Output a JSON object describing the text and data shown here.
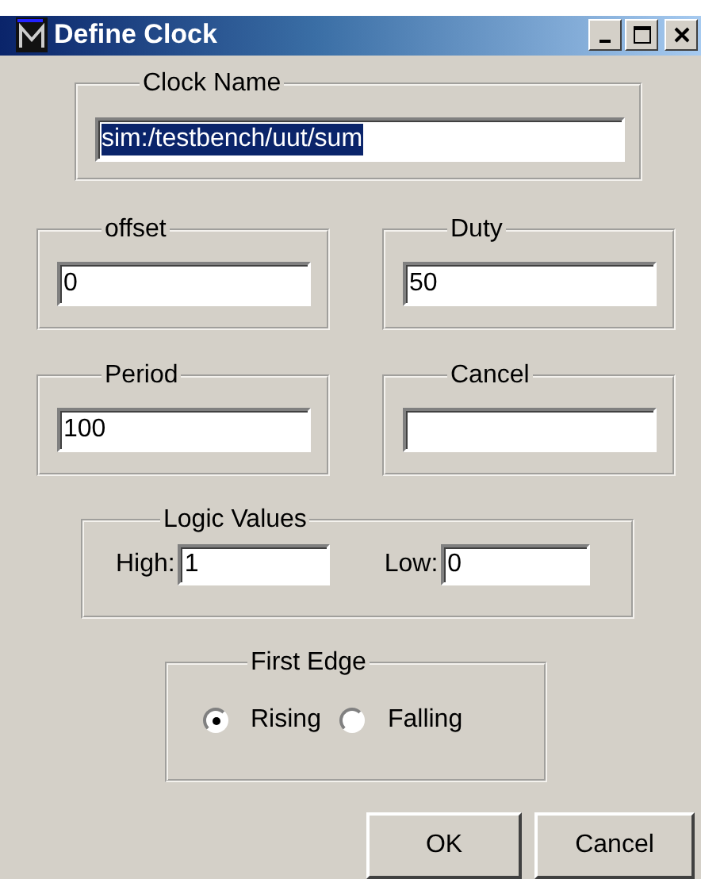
{
  "window": {
    "title": "Define Clock"
  },
  "clock_name": {
    "label": "Clock Name",
    "value": "sim:/testbench/uut/sum",
    "text_selected": true
  },
  "fields": [
    {
      "label": "offset",
      "value": "0"
    },
    {
      "label": "Duty",
      "value": "50"
    },
    {
      "label": "Period",
      "value": "100"
    },
    {
      "label": "Cancel"
    }
  ],
  "logic_values": {
    "label": "Logic Values",
    "high": {
      "label": "High:",
      "value": "1"
    },
    "low": {
      "label": "Low:",
      "value": "0"
    }
  },
  "first_edge": {
    "label": "First Edge",
    "options": [
      {
        "label": "Rising",
        "selected": true
      },
      {
        "label": "Falling",
        "selected": false
      }
    ]
  },
  "buttons": [
    "OK",
    "Cancel"
  ]
}
